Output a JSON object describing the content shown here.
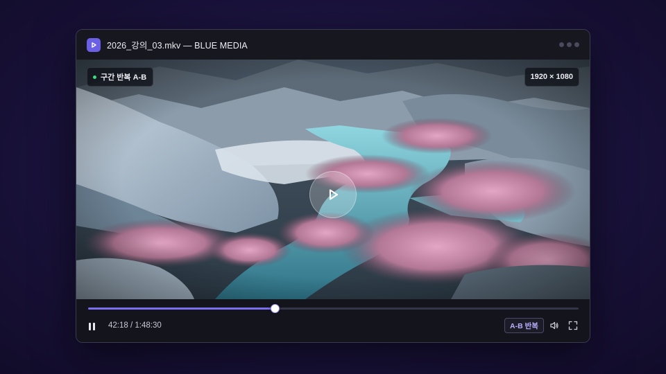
{
  "window": {
    "title": "2026_강의_03.mkv — BLUE MEDIA",
    "app_icon": "play-icon",
    "menu_icon": "more-dots-icon"
  },
  "video": {
    "loop_badge": "구간 반복 A-B",
    "loop_status_color": "#3ddc84",
    "resolution_badge": "1920 × 1080",
    "center_button_icon": "play-icon"
  },
  "controls": {
    "progress_fraction": 0.38,
    "timecode": "42:18 / 1:48:30",
    "ab_repeat_label": "A-B 반복",
    "pause_icon": "pause-icon",
    "volume_icon": "volume-icon",
    "fullscreen_icon": "fullscreen-icon"
  },
  "colors": {
    "accent": "#7b6ff0",
    "app_icon_bg": "#6b5fe6",
    "ab_label": "#b7aeff"
  }
}
